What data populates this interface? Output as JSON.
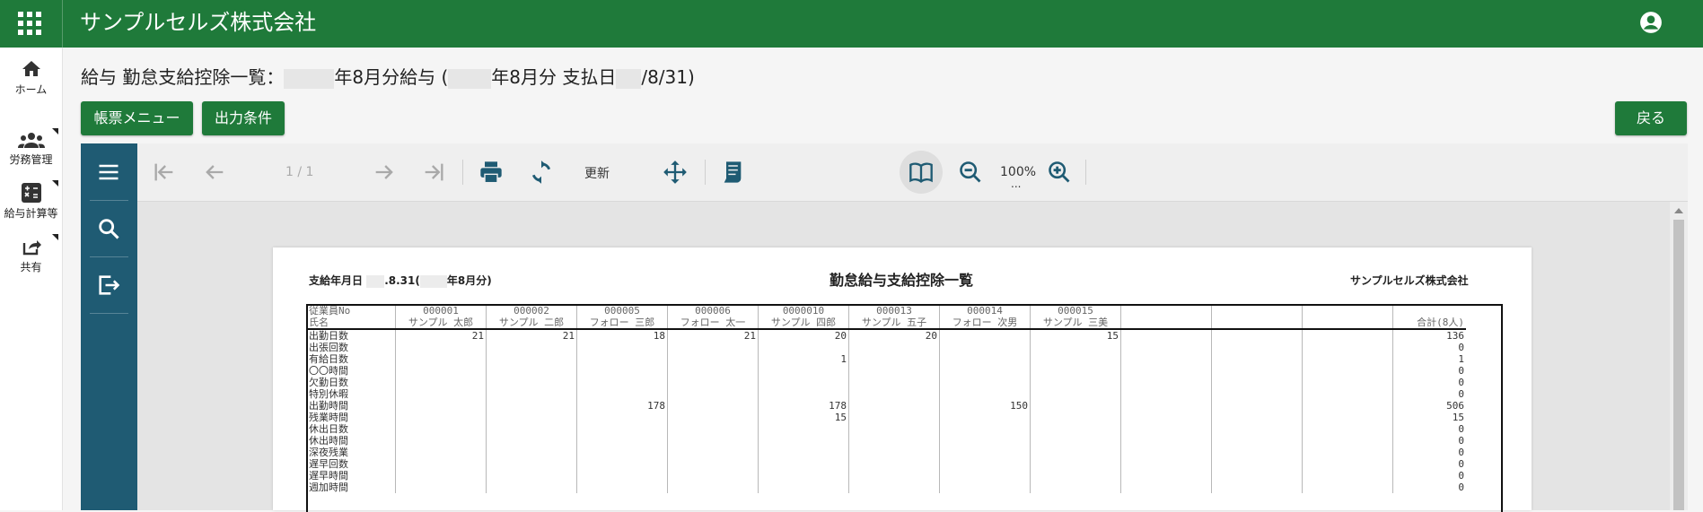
{
  "header": {
    "company": "サンプルセルズ株式会社",
    "apps_icon": "apps-grid-icon",
    "account_icon": "account-circle-icon"
  },
  "sidebar": {
    "items": [
      {
        "label": "ホーム",
        "icon": "home-icon"
      },
      {
        "label": "労務管理",
        "icon": "people-group-icon"
      },
      {
        "label": "給与計算等",
        "icon": "calculator-icon"
      },
      {
        "label": "共有",
        "icon": "share-icon"
      }
    ]
  },
  "page": {
    "title_part1": "給与 勤怠支給控除一覧：",
    "title_part2": "年8月分給与 (",
    "title_part3": "年8月分 支払日",
    "title_part4": "/8/31)"
  },
  "buttons": {
    "report_menu": "帳票メニュー",
    "output_conditions": "出力条件",
    "back": "戻る"
  },
  "viewer": {
    "page_indicator": "1 / 1",
    "refresh_label": "更新",
    "zoom_level": "100%",
    "zoom_more": "..."
  },
  "report": {
    "date_label_part1": "支給年月日",
    "date_label_part2": ".8.31(",
    "date_label_part3": "年8月分)",
    "title": "勤怠給与支給控除一覧",
    "company": "サンプルセルズ株式会社",
    "header_row1": [
      "従業員No",
      "000001",
      "000002",
      "000005",
      "000006",
      "0000010",
      "000013",
      "000014",
      "000015",
      "",
      "",
      "",
      ""
    ],
    "header_row2": [
      "氏名",
      "サンプル 太郎",
      "サンプル 二郎",
      "フォロー 三郎",
      "フォロー 太一",
      "サンプル 四郎",
      "サンプル 五子",
      "フォロー 次男",
      "サンプル 三美",
      "",
      "",
      "",
      "合計(8人)"
    ],
    "rows": [
      [
        "出勤日数",
        "21",
        "21",
        "18",
        "21",
        "20",
        "20",
        "",
        "15",
        "",
        "",
        "",
        "136"
      ],
      [
        "出張回数",
        "",
        "",
        "",
        "",
        "",
        "",
        "",
        "",
        "",
        "",
        "",
        "0"
      ],
      [
        "有給日数",
        "",
        "",
        "",
        "",
        "1",
        "",
        "",
        "",
        "",
        "",
        "",
        "1"
      ],
      [
        "〇〇時間",
        "",
        "",
        "",
        "",
        "",
        "",
        "",
        "",
        "",
        "",
        "",
        "0"
      ],
      [
        "欠勤日数",
        "",
        "",
        "",
        "",
        "",
        "",
        "",
        "",
        "",
        "",
        "",
        "0"
      ],
      [
        "特別休暇",
        "",
        "",
        "",
        "",
        "",
        "",
        "",
        "",
        "",
        "",
        "",
        "0"
      ],
      [
        "出勤時間",
        "",
        "",
        "178",
        "",
        "178",
        "",
        "150",
        "",
        "",
        "",
        "",
        "506"
      ],
      [
        "残業時間",
        "",
        "",
        "",
        "",
        "15",
        "",
        "",
        "",
        "",
        "",
        "",
        "15"
      ],
      [
        "休出日数",
        "",
        "",
        "",
        "",
        "",
        "",
        "",
        "",
        "",
        "",
        "",
        "0"
      ],
      [
        "休出時間",
        "",
        "",
        "",
        "",
        "",
        "",
        "",
        "",
        "",
        "",
        "",
        "0"
      ],
      [
        "深夜残業",
        "",
        "",
        "",
        "",
        "",
        "",
        "",
        "",
        "",
        "",
        "",
        "0"
      ],
      [
        "遅早回数",
        "",
        "",
        "",
        "",
        "",
        "",
        "",
        "",
        "",
        "",
        "",
        "0"
      ],
      [
        "遅早時間",
        "",
        "",
        "",
        "",
        "",
        "",
        "",
        "",
        "",
        "",
        "",
        "0"
      ],
      [
        "週加時間",
        "",
        "",
        "",
        "",
        "",
        "",
        "",
        "",
        "",
        "",
        "",
        "0"
      ]
    ]
  },
  "colors": {
    "brand_green": "#1f7a3a",
    "viewer_teal": "#1f5b73"
  }
}
